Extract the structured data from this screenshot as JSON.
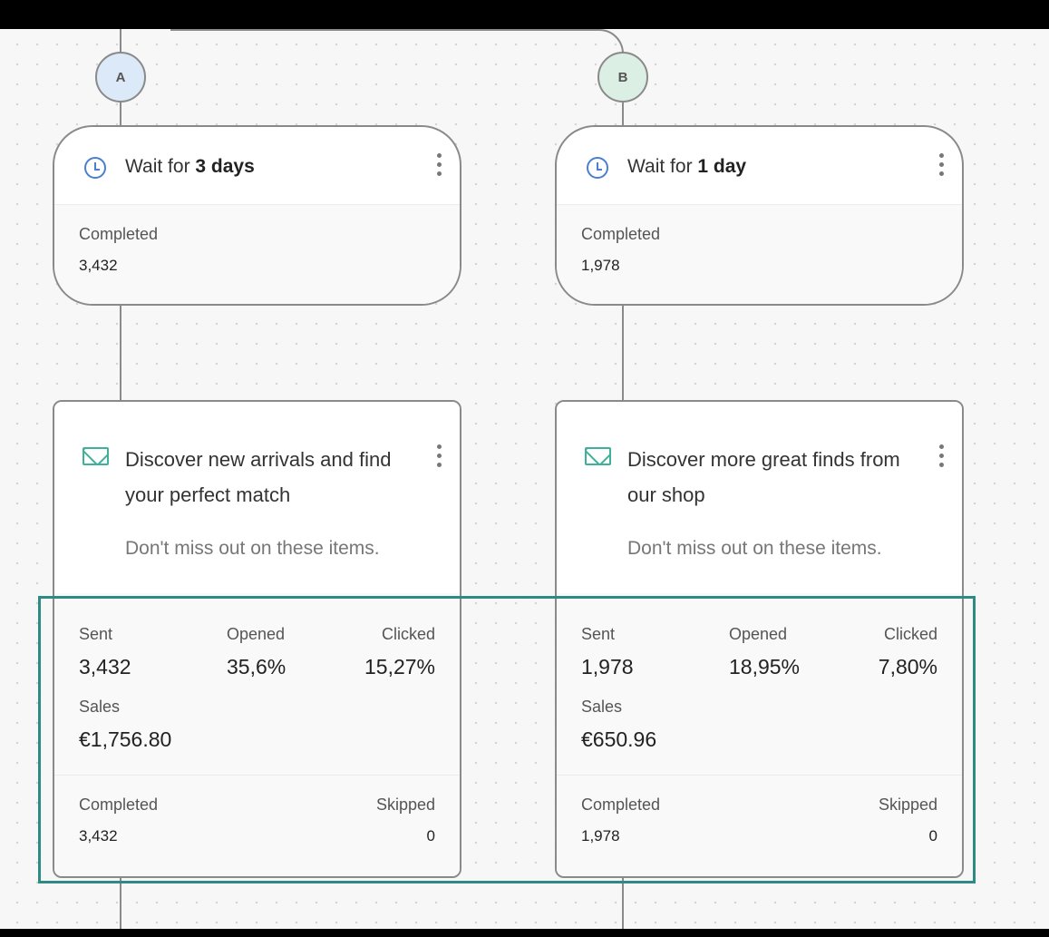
{
  "branches": {
    "a": {
      "badge": "A",
      "wait": {
        "prefix": "Wait for ",
        "duration": "3 days",
        "completed_label": "Completed",
        "completed_value": "3,432"
      },
      "email": {
        "subject": "Discover new arrivals and find your perfect match",
        "preheader": "Don't miss out on these items.",
        "sent_label": "Sent",
        "sent_value": "3,432",
        "opened_label": "Opened",
        "opened_value": "35,6%",
        "clicked_label": "Clicked",
        "clicked_value": "15,27%",
        "sales_label": "Sales",
        "sales_value": "€1,756.80",
        "completed_label": "Completed",
        "completed_value": "3,432",
        "skipped_label": "Skipped",
        "skipped_value": "0"
      }
    },
    "b": {
      "badge": "B",
      "wait": {
        "prefix": "Wait for ",
        "duration": "1 day",
        "completed_label": "Completed",
        "completed_value": "1,978"
      },
      "email": {
        "subject": "Discover more great finds from our shop",
        "preheader": "Don't miss out on these items.",
        "sent_label": "Sent",
        "sent_value": "1,978",
        "opened_label": "Opened",
        "opened_value": "18,95%",
        "clicked_label": "Clicked",
        "clicked_value": "7,80%",
        "sales_label": "Sales",
        "sales_value": "€650.96",
        "completed_label": "Completed",
        "completed_value": "1,978",
        "skipped_label": "Skipped",
        "skipped_value": "0"
      }
    }
  },
  "colors": {
    "highlight": "#2e8a84",
    "badge_a_bg": "#dce9f8",
    "badge_b_bg": "#dcefe5",
    "clock_icon": "#4a7fd0",
    "mail_icon": "#3fb09a"
  }
}
